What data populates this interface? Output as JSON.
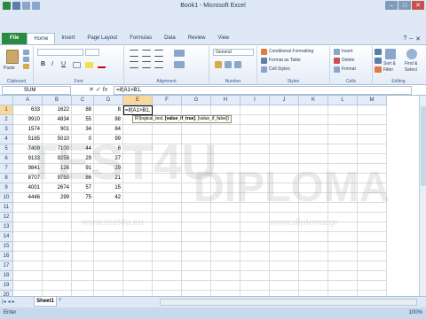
{
  "window": {
    "title": "Book1 - Microsoft Excel"
  },
  "tabs": [
    "File",
    "Home",
    "Insert",
    "Page Layout",
    "Formulas",
    "Data",
    "Review",
    "View"
  ],
  "ribbon": {
    "clipboard": {
      "paste": "Paste",
      "label": "Clipboard"
    },
    "font": {
      "label": "Font",
      "bold": "B",
      "italic": "I",
      "underline": "U"
    },
    "alignment": {
      "label": "Alignment"
    },
    "number": {
      "format": "General",
      "label": "Number"
    },
    "styles": {
      "conditional": "Conditional Formatting",
      "format_table": "Format as Table",
      "cell_styles": "Cell Styles",
      "label": "Styles"
    },
    "cells": {
      "insert": "Insert",
      "delete": "Delete",
      "format": "Format",
      "label": "Cells"
    },
    "editing": {
      "sort": "Sort &",
      "filter": "Filter",
      "find": "Find &",
      "select": "Select",
      "label": "Editing"
    }
  },
  "formula_bar": {
    "name_box": "SUM",
    "formula": "=if(A1>B1,"
  },
  "columns": [
    "A",
    "B",
    "C",
    "D",
    "E",
    "F",
    "G",
    "H",
    "I",
    "J",
    "K",
    "L",
    "M"
  ],
  "rows": [
    [
      "633",
      "1622",
      "88",
      "8",
      "=if(A1>B1,"
    ],
    [
      "9910",
      "4834",
      "55",
      "88",
      ""
    ],
    [
      "1574",
      "901",
      "34",
      "84",
      ""
    ],
    [
      "5165",
      "5010",
      "0",
      "99",
      ""
    ],
    [
      "7409",
      "7100",
      "44",
      "8",
      ""
    ],
    [
      "9133",
      "9258",
      "29",
      "27",
      ""
    ],
    [
      "9841",
      "126",
      "91",
      "29",
      ""
    ],
    [
      "8707",
      "9750",
      "86",
      "21",
      ""
    ],
    [
      "4001",
      "2674",
      "57",
      "15",
      ""
    ],
    [
      "4446",
      "299",
      "75",
      "42",
      ""
    ]
  ],
  "tooltip": {
    "prefix": "IF(",
    "arg1": "logical_test,",
    "arg2": "[value_if_true]",
    "sep": ",",
    "arg3": "[value_if_false]",
    "suffix": ")"
  },
  "watermark": {
    "brand1": "TEST4U",
    "brand2": "DIPLOMA",
    "url1": "www.test4u.eu",
    "url2": "www.diploma.gr"
  },
  "sheet": {
    "tab": "Sheet1"
  },
  "status": {
    "mode": "Enter",
    "zoom": "100%"
  }
}
